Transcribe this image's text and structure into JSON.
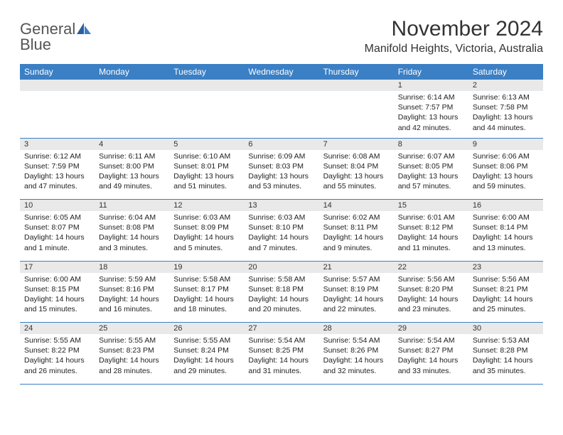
{
  "logo": {
    "top": "General",
    "bottom": "Blue"
  },
  "title": "November 2024",
  "location": "Manifold Heights, Victoria, Australia",
  "dayHeaders": [
    "Sunday",
    "Monday",
    "Tuesday",
    "Wednesday",
    "Thursday",
    "Friday",
    "Saturday"
  ],
  "weeks": [
    [
      null,
      null,
      null,
      null,
      null,
      {
        "n": "1",
        "sunrise": "6:14 AM",
        "sunset": "7:57 PM",
        "daylight": "13 hours and 42 minutes."
      },
      {
        "n": "2",
        "sunrise": "6:13 AM",
        "sunset": "7:58 PM",
        "daylight": "13 hours and 44 minutes."
      }
    ],
    [
      {
        "n": "3",
        "sunrise": "6:12 AM",
        "sunset": "7:59 PM",
        "daylight": "13 hours and 47 minutes."
      },
      {
        "n": "4",
        "sunrise": "6:11 AM",
        "sunset": "8:00 PM",
        "daylight": "13 hours and 49 minutes."
      },
      {
        "n": "5",
        "sunrise": "6:10 AM",
        "sunset": "8:01 PM",
        "daylight": "13 hours and 51 minutes."
      },
      {
        "n": "6",
        "sunrise": "6:09 AM",
        "sunset": "8:03 PM",
        "daylight": "13 hours and 53 minutes."
      },
      {
        "n": "7",
        "sunrise": "6:08 AM",
        "sunset": "8:04 PM",
        "daylight": "13 hours and 55 minutes."
      },
      {
        "n": "8",
        "sunrise": "6:07 AM",
        "sunset": "8:05 PM",
        "daylight": "13 hours and 57 minutes."
      },
      {
        "n": "9",
        "sunrise": "6:06 AM",
        "sunset": "8:06 PM",
        "daylight": "13 hours and 59 minutes."
      }
    ],
    [
      {
        "n": "10",
        "sunrise": "6:05 AM",
        "sunset": "8:07 PM",
        "daylight": "14 hours and 1 minute."
      },
      {
        "n": "11",
        "sunrise": "6:04 AM",
        "sunset": "8:08 PM",
        "daylight": "14 hours and 3 minutes."
      },
      {
        "n": "12",
        "sunrise": "6:03 AM",
        "sunset": "8:09 PM",
        "daylight": "14 hours and 5 minutes."
      },
      {
        "n": "13",
        "sunrise": "6:03 AM",
        "sunset": "8:10 PM",
        "daylight": "14 hours and 7 minutes."
      },
      {
        "n": "14",
        "sunrise": "6:02 AM",
        "sunset": "8:11 PM",
        "daylight": "14 hours and 9 minutes."
      },
      {
        "n": "15",
        "sunrise": "6:01 AM",
        "sunset": "8:12 PM",
        "daylight": "14 hours and 11 minutes."
      },
      {
        "n": "16",
        "sunrise": "6:00 AM",
        "sunset": "8:14 PM",
        "daylight": "14 hours and 13 minutes."
      }
    ],
    [
      {
        "n": "17",
        "sunrise": "6:00 AM",
        "sunset": "8:15 PM",
        "daylight": "14 hours and 15 minutes."
      },
      {
        "n": "18",
        "sunrise": "5:59 AM",
        "sunset": "8:16 PM",
        "daylight": "14 hours and 16 minutes."
      },
      {
        "n": "19",
        "sunrise": "5:58 AM",
        "sunset": "8:17 PM",
        "daylight": "14 hours and 18 minutes."
      },
      {
        "n": "20",
        "sunrise": "5:58 AM",
        "sunset": "8:18 PM",
        "daylight": "14 hours and 20 minutes."
      },
      {
        "n": "21",
        "sunrise": "5:57 AM",
        "sunset": "8:19 PM",
        "daylight": "14 hours and 22 minutes."
      },
      {
        "n": "22",
        "sunrise": "5:56 AM",
        "sunset": "8:20 PM",
        "daylight": "14 hours and 23 minutes."
      },
      {
        "n": "23",
        "sunrise": "5:56 AM",
        "sunset": "8:21 PM",
        "daylight": "14 hours and 25 minutes."
      }
    ],
    [
      {
        "n": "24",
        "sunrise": "5:55 AM",
        "sunset": "8:22 PM",
        "daylight": "14 hours and 26 minutes."
      },
      {
        "n": "25",
        "sunrise": "5:55 AM",
        "sunset": "8:23 PM",
        "daylight": "14 hours and 28 minutes."
      },
      {
        "n": "26",
        "sunrise": "5:55 AM",
        "sunset": "8:24 PM",
        "daylight": "14 hours and 29 minutes."
      },
      {
        "n": "27",
        "sunrise": "5:54 AM",
        "sunset": "8:25 PM",
        "daylight": "14 hours and 31 minutes."
      },
      {
        "n": "28",
        "sunrise": "5:54 AM",
        "sunset": "8:26 PM",
        "daylight": "14 hours and 32 minutes."
      },
      {
        "n": "29",
        "sunrise": "5:54 AM",
        "sunset": "8:27 PM",
        "daylight": "14 hours and 33 minutes."
      },
      {
        "n": "30",
        "sunrise": "5:53 AM",
        "sunset": "8:28 PM",
        "daylight": "14 hours and 35 minutes."
      }
    ]
  ],
  "labels": {
    "sunrise": "Sunrise:",
    "sunset": "Sunset:",
    "daylight": "Daylight:"
  }
}
